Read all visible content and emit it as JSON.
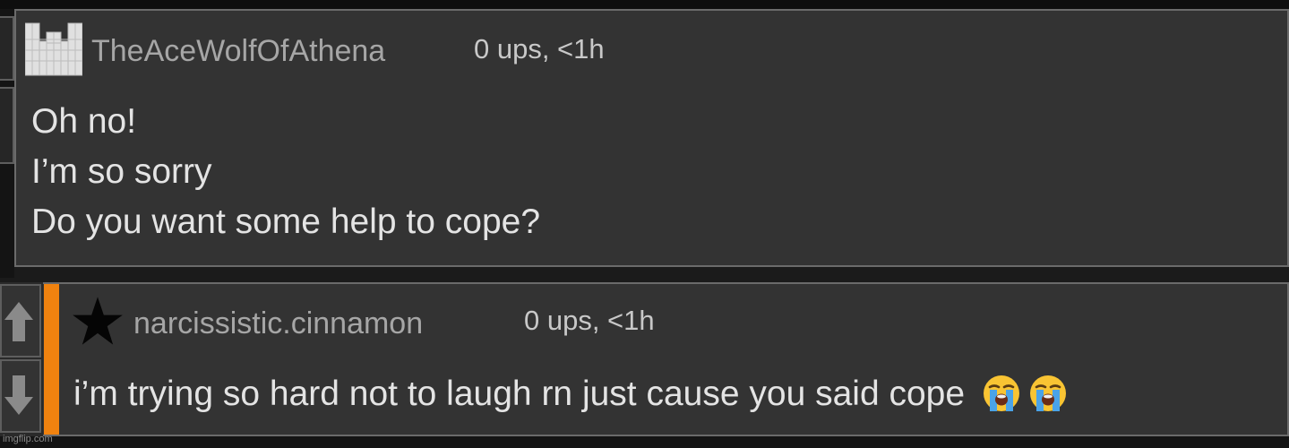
{
  "comments": [
    {
      "username": "TheAceWolfOfAthena",
      "meta": "0 ups, <1h",
      "lines": [
        "Oh no!",
        "I’m so sorry",
        "Do you want some help to cope?"
      ]
    },
    {
      "username": "narcissistic.cinnamon",
      "meta": "0 ups, <1h",
      "text": "i’m trying so hard not to laugh rn just cause you said cope"
    }
  ],
  "watermark": "imgflip.com",
  "colors": {
    "background": "#1b1b1b",
    "panel": "#333333",
    "border": "#6b6b6b",
    "accent": "#f0820f",
    "username": "#a6a6a6",
    "text": "#e4e4e4"
  },
  "icons": {
    "avatar": "castle-avatar-icon",
    "badge": "star-icon",
    "emoji": "loudly-crying-face-emoji",
    "upvote": "arrow-up-icon",
    "downvote": "arrow-down-icon"
  }
}
